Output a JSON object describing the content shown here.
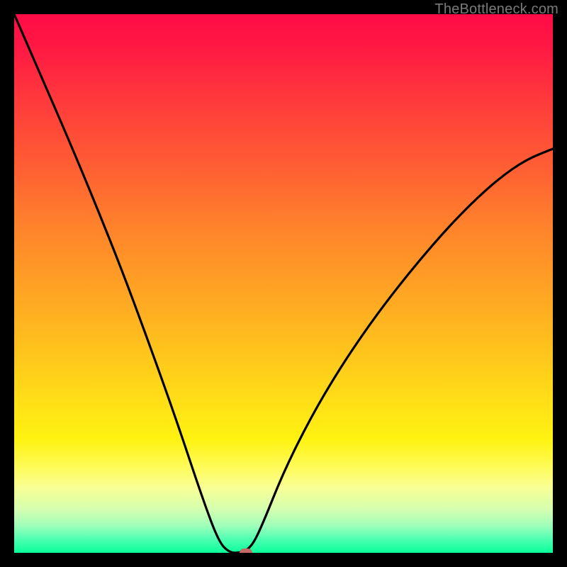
{
  "watermark": "TheBottleneck.com",
  "chart_data": {
    "type": "line",
    "title": "",
    "xlabel": "",
    "ylabel": "",
    "xlim": [
      0,
      1
    ],
    "ylim": [
      0,
      1
    ],
    "grid": false,
    "legend": false,
    "series": [
      {
        "name": "bottleneck-curve",
        "x": [
          0.0,
          0.05,
          0.1,
          0.15,
          0.2,
          0.25,
          0.3,
          0.35,
          0.38,
          0.4,
          0.42,
          0.44,
          0.46,
          0.5,
          0.55,
          0.6,
          0.65,
          0.7,
          0.75,
          0.8,
          0.85,
          0.9,
          0.95,
          1.0
        ],
        "y": [
          1.0,
          0.885,
          0.77,
          0.65,
          0.525,
          0.39,
          0.25,
          0.1,
          0.02,
          0.0,
          0.0,
          0.01,
          0.05,
          0.15,
          0.25,
          0.335,
          0.41,
          0.478,
          0.54,
          0.598,
          0.65,
          0.695,
          0.73,
          0.75
        ]
      }
    ],
    "marker": {
      "x": 0.43,
      "y": 0.0
    },
    "colors": {
      "curve": "#000000",
      "marker": "#c46a64",
      "gradient_top": "#ff0b46",
      "gradient_bottom": "#09ff9a"
    }
  }
}
